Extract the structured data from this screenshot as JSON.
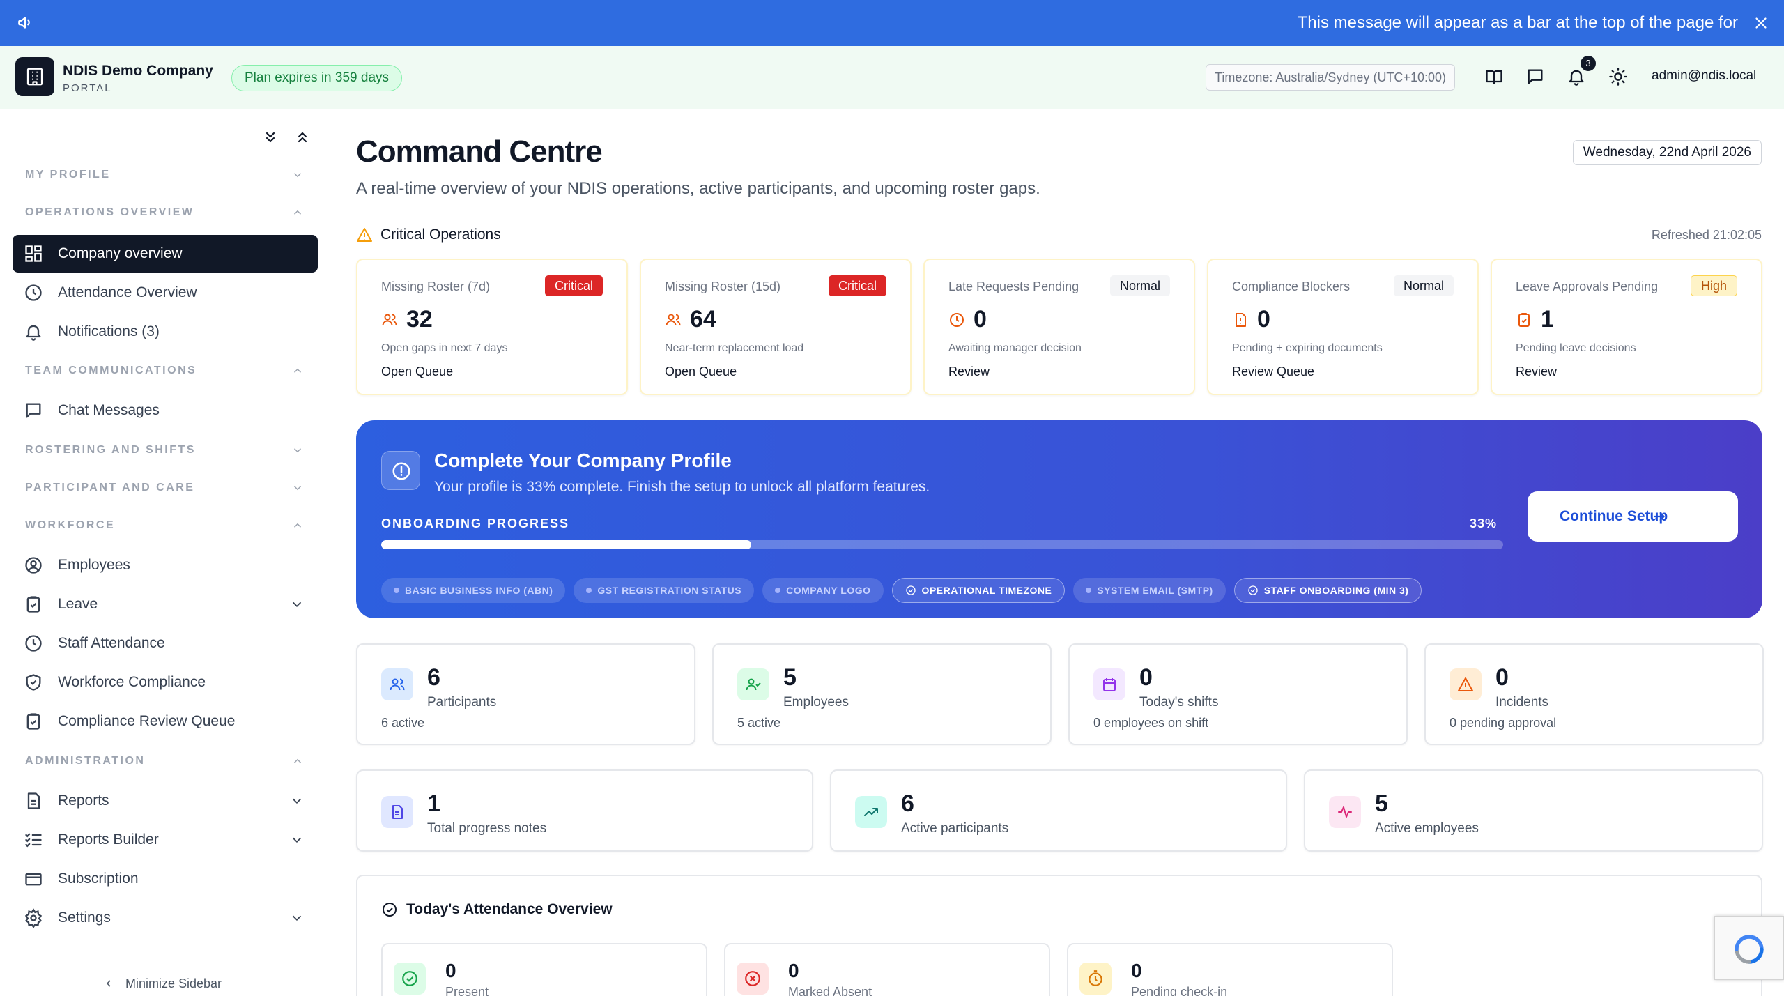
{
  "announcement": {
    "message": "This message will appear as a bar at the top of the page for"
  },
  "header": {
    "company_name": "NDIS Demo Company",
    "company_sub": "PORTAL",
    "plan_badge": "Plan expires in 359 days",
    "timezone": "Timezone: Australia/Sydney (UTC+10:00)",
    "notification_count": "3",
    "user_email": "admin@ndis.local"
  },
  "sidebar": {
    "sections": {
      "my_profile": "MY PROFILE",
      "operations_overview": "OPERATIONS OVERVIEW",
      "team_communications": "TEAM COMMUNICATIONS",
      "rostering_and_shifts": "ROSTERING AND SHIFTS",
      "participant_and_care": "PARTICIPANT AND CARE",
      "workforce": "WORKFORCE",
      "administration": "ADMINISTRATION"
    },
    "items": {
      "company_overview": "Company overview",
      "attendance_overview": "Attendance Overview",
      "notifications": "Notifications (3)",
      "chat_messages": "Chat Messages",
      "employees": "Employees",
      "leave": "Leave",
      "staff_attendance": "Staff Attendance",
      "workforce_compliance": "Workforce Compliance",
      "compliance_review_queue": "Compliance Review Queue",
      "reports": "Reports",
      "reports_builder": "Reports Builder",
      "subscription": "Subscription",
      "settings": "Settings"
    },
    "minimize": "Minimize Sidebar"
  },
  "main": {
    "title": "Command Centre",
    "subtitle": "A real-time overview of your NDIS operations, active participants, and upcoming roster gaps.",
    "date": "Wednesday, 22nd April 2026",
    "critical_title": "Critical Operations",
    "refreshed": "Refreshed 21:02:05",
    "critical_cards": [
      {
        "title": "Missing Roster (7d)",
        "badge": "Critical",
        "value": "32",
        "desc": "Open gaps in next 7 days",
        "action": "Open Queue"
      },
      {
        "title": "Missing Roster (15d)",
        "badge": "Critical",
        "value": "64",
        "desc": "Near-term replacement load",
        "action": "Open Queue"
      },
      {
        "title": "Late Requests Pending",
        "badge": "Normal",
        "value": "0",
        "desc": "Awaiting manager decision",
        "action": "Review"
      },
      {
        "title": "Compliance Blockers",
        "badge": "Normal",
        "value": "0",
        "desc": "Pending + expiring documents",
        "action": "Review Queue"
      },
      {
        "title": "Leave Approvals Pending",
        "badge": "High",
        "value": "1",
        "desc": "Pending leave decisions",
        "action": "Review"
      }
    ],
    "onboarding": {
      "title": "Complete Your Company Profile",
      "subtitle": "Your profile is 33% complete. Finish the setup to unlock all platform features.",
      "progress_label": "ONBOARDING PROGRESS",
      "progress_percent": "33%",
      "progress_value": 33,
      "cta": "Continue Setup",
      "steps": [
        {
          "label": "BASIC BUSINESS INFO (ABN)",
          "done": false
        },
        {
          "label": "GST REGISTRATION STATUS",
          "done": false
        },
        {
          "label": "COMPANY LOGO",
          "done": false
        },
        {
          "label": "OPERATIONAL TIMEZONE",
          "done": true
        },
        {
          "label": "SYSTEM EMAIL (SMTP)",
          "done": false
        },
        {
          "label": "STAFF ONBOARDING (MIN 3)",
          "done": true
        }
      ]
    },
    "stats_row1": [
      {
        "value": "6",
        "label": "Participants",
        "desc": "6 active"
      },
      {
        "value": "5",
        "label": "Employees",
        "desc": "5 active"
      },
      {
        "value": "0",
        "label": "Today's shifts",
        "desc": "0 employees on shift"
      },
      {
        "value": "0",
        "label": "Incidents",
        "desc": "0 pending approval"
      }
    ],
    "stats_row2": [
      {
        "value": "1",
        "label": "Total progress notes"
      },
      {
        "value": "6",
        "label": "Active participants"
      },
      {
        "value": "5",
        "label": "Active employees"
      }
    ],
    "attendance": {
      "title": "Today's Attendance Overview",
      "cards": [
        {
          "value": "0",
          "label": "Present"
        },
        {
          "value": "0",
          "label": "Marked Absent"
        },
        {
          "value": "0",
          "label": "Pending check-in"
        }
      ]
    }
  },
  "colors": {
    "announcement_bg": "#2f6ce0",
    "active_nav_bg": "#111827",
    "critical": "#dc2626",
    "high": "#b45309",
    "accent": "#1d4ed8"
  }
}
